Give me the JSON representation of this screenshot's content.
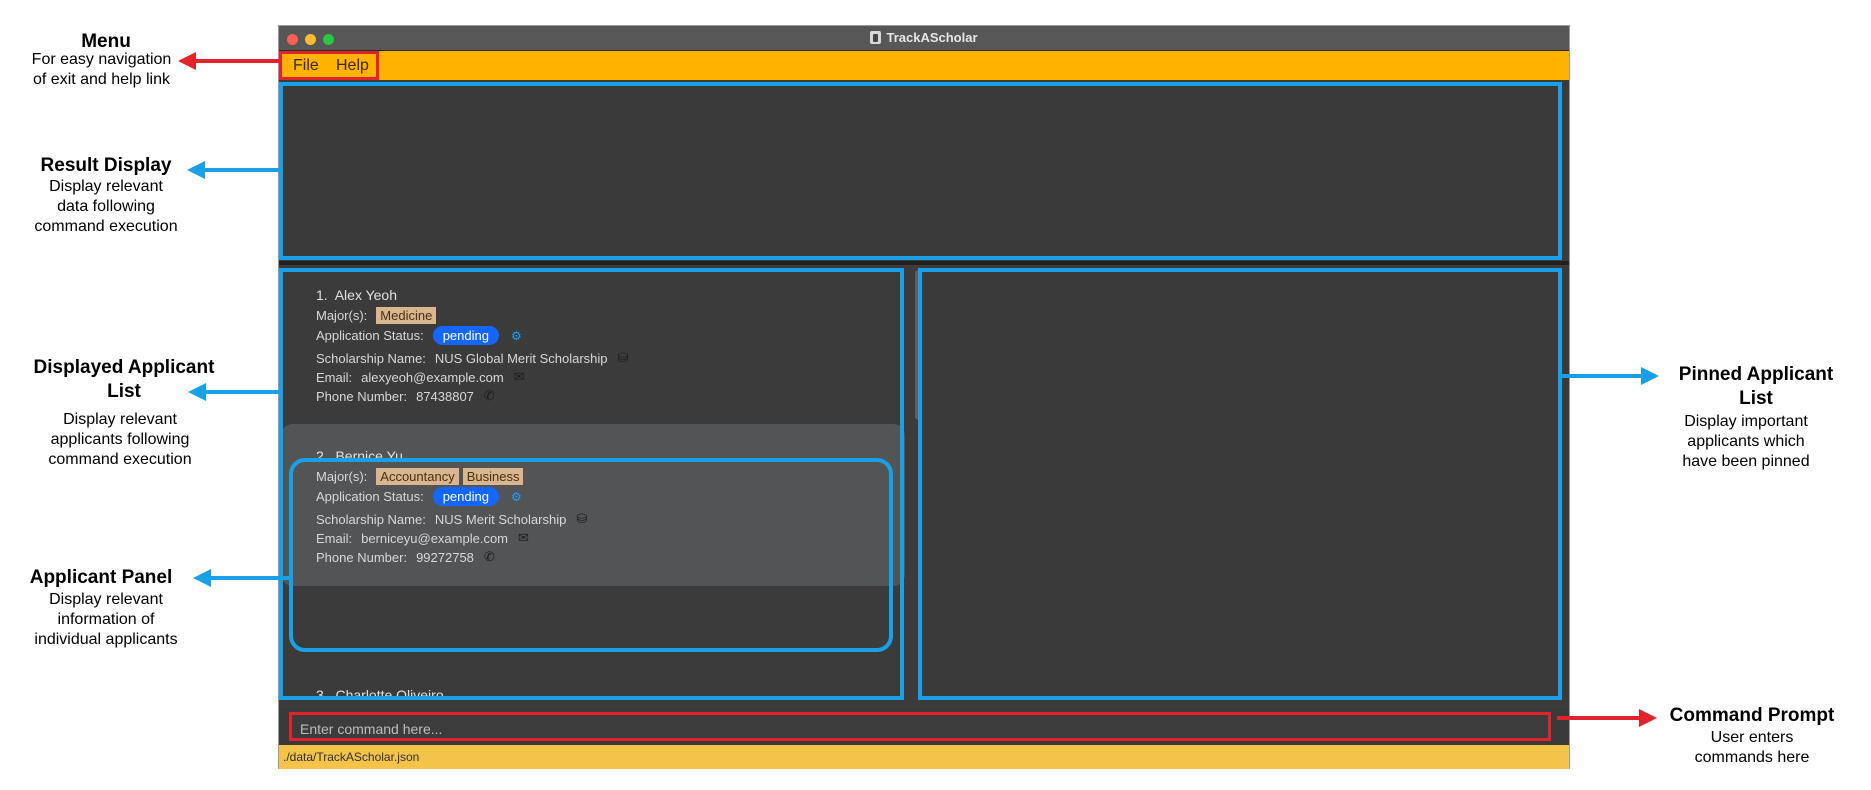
{
  "window": {
    "title": "TrackAScholar",
    "traffic_lights": [
      "#ff5f57",
      "#febc2e",
      "#28c840"
    ]
  },
  "menu": {
    "file": "File",
    "help": "Help"
  },
  "applicants": [
    {
      "index": "1.",
      "name": "Alex Yeoh",
      "majors_label": "Major(s):",
      "majors": [
        "Medicine"
      ],
      "status_label": "Application Status:",
      "status": "pending",
      "scholarship_label": "Scholarship Name:",
      "scholarship": "NUS Global Merit Scholarship",
      "email_label": "Email:",
      "email": "alexyeoh@example.com",
      "phone_label": "Phone Number:",
      "phone": "87438807"
    },
    {
      "index": "2.",
      "name": "Bernice Yu",
      "majors_label": "Major(s):",
      "majors": [
        "Accountancy",
        "Business"
      ],
      "status_label": "Application Status:",
      "status": "pending",
      "scholarship_label": "Scholarship Name:",
      "scholarship": "NUS Merit Scholarship",
      "email_label": "Email:",
      "email": "berniceyu@example.com",
      "phone_label": "Phone Number:",
      "phone": "99272758"
    },
    {
      "index": "3.",
      "name": "Charlotte Oliveiro"
    }
  ],
  "command": {
    "placeholder": "Enter command here..."
  },
  "status_bar": {
    "path": "./data/TrackAScholar.json"
  },
  "annotations": {
    "menu": {
      "title": "Menu",
      "desc": [
        "For easy navigation",
        "of exit and help link"
      ]
    },
    "result": {
      "title": "Result Display",
      "desc": [
        "Display relevant",
        "data following",
        "command execution"
      ]
    },
    "list": {
      "title": [
        "Displayed Applicant",
        "List"
      ],
      "desc": [
        "Display relevant",
        "applicants following",
        "command execution"
      ]
    },
    "panel": {
      "title": "Applicant Panel",
      "desc": [
        "Display relevant",
        "information of",
        "individual applicants"
      ]
    },
    "pinned": {
      "title": [
        "Pinned Applicant",
        "List"
      ],
      "desc": [
        "Display important",
        "applicants which",
        "have been pinned"
      ]
    },
    "command": {
      "title": "Command Prompt",
      "desc": [
        "User enters",
        "commands here"
      ]
    }
  },
  "colors": {
    "annotation_blue": "#1aa0e6",
    "annotation_red": "#e3232b",
    "menubar": "#ffb300",
    "status_pill": "#1565ff"
  }
}
